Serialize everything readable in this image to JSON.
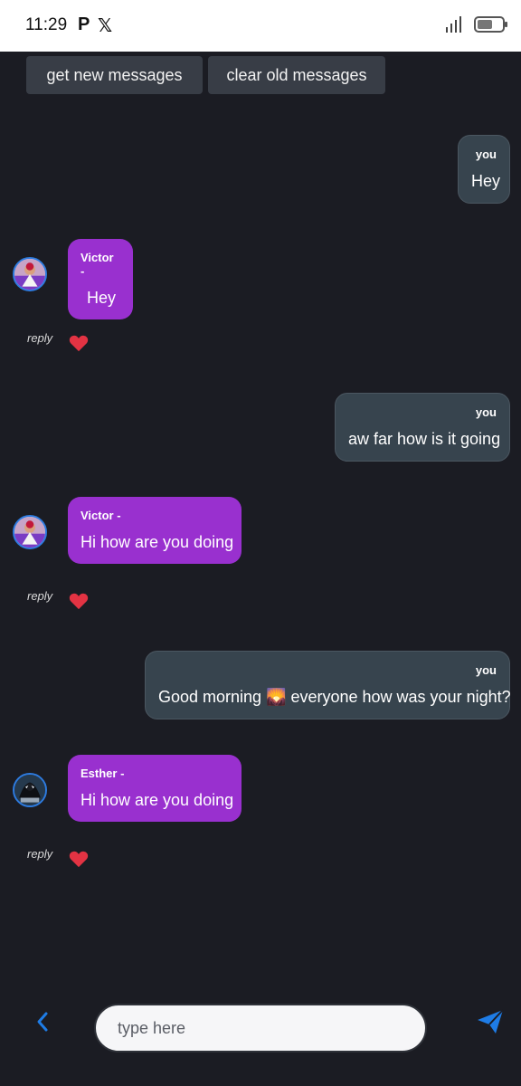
{
  "status_bar": {
    "time": "11:29",
    "app_icons": [
      "P",
      "𝕏"
    ],
    "signal_icon": "signal-icon",
    "battery_icon": "battery-icon"
  },
  "toolbar": {
    "get_new": "get new messages",
    "clear_old": "clear old messages"
  },
  "messages": [
    {
      "sender": "you",
      "text": "Hey",
      "own": true
    },
    {
      "sender": "Victor -",
      "text": "Hey",
      "own": false,
      "avatar": "avatar-victor",
      "reply": "reply"
    },
    {
      "sender": "you",
      "text": "aw far how is it going",
      "own": true
    },
    {
      "sender": "Victor -",
      "text": "Hi how are you doing",
      "own": false,
      "avatar": "avatar-victor",
      "reply": "reply"
    },
    {
      "sender": "you",
      "text": "Good morning 🌄 everyone how was your night?",
      "own": true
    },
    {
      "sender": "Esther -",
      "text": "Hi how are you doing",
      "own": false,
      "avatar": "avatar-esther",
      "reply": "reply"
    }
  ],
  "composer": {
    "placeholder": "type here",
    "back_icon": "chevron-left-icon",
    "send_icon": "send-icon"
  },
  "colors": {
    "background": "#1b1c23",
    "own_bubble": "#37444e",
    "other_bubble": "#9930cf",
    "accent": "#1e7ce6",
    "heart": "#e33343"
  }
}
